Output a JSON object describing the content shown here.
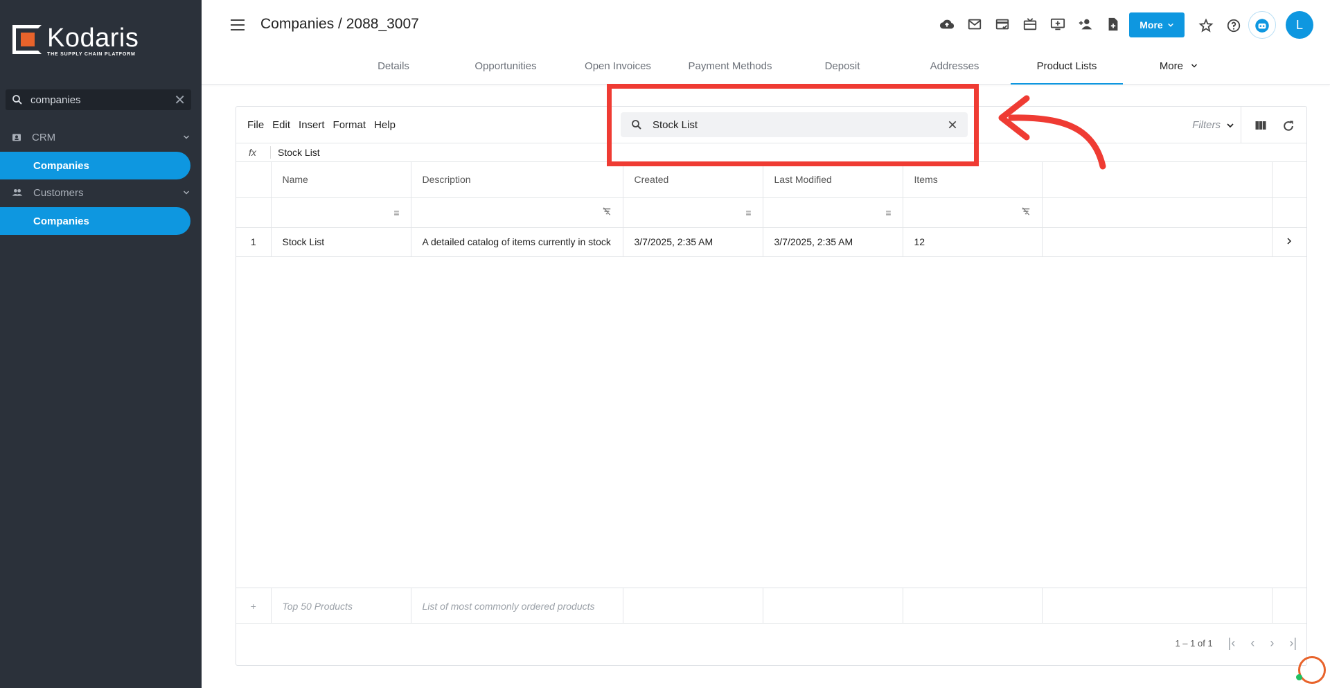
{
  "sidebar": {
    "logo": {
      "name": "Kodaris",
      "tagline": "THE SUPPLY CHAIN PLATFORM"
    },
    "search_value": "companies",
    "groups": [
      {
        "label": "CRM",
        "item": "Companies"
      },
      {
        "label": "Customers",
        "item": "Companies"
      }
    ]
  },
  "header": {
    "title": "Companies / 2088_3007",
    "more_label": "More",
    "avatar_initial": "L",
    "tabs": [
      "Details",
      "Opportunities",
      "Open Invoices",
      "Payment Methods",
      "Deposit",
      "Addresses",
      "Product Lists",
      "More"
    ],
    "active_tab": "Product Lists",
    "icons": [
      "cloud-upload-icon",
      "mail-icon",
      "credit-card-icon",
      "gift-card-icon",
      "add-to-screen-icon",
      "add-person-icon",
      "add-document-icon",
      "attachment-icon"
    ]
  },
  "grid": {
    "menu": [
      "File",
      "Edit",
      "Insert",
      "Format",
      "Help"
    ],
    "search_value": "Stock List",
    "filters_label": "Filters",
    "formula_prefix": "fx",
    "formula_value": "Stock List",
    "columns": [
      "Name",
      "Description",
      "Created",
      "Last Modified",
      "Items"
    ],
    "rows": [
      {
        "num": "1",
        "name": "Stock List",
        "description": "A detailed catalog of items currently in stock",
        "created": "3/7/2025, 2:35 AM",
        "modified": "3/7/2025, 2:35 AM",
        "items": "12"
      }
    ],
    "new_row": {
      "name_placeholder": "Top 50 Products",
      "description_placeholder": "List of most commonly ordered products"
    },
    "pagination": "1 – 1 of 1"
  },
  "colors": {
    "accent": "#0e97e0",
    "sidebar": "#2b313a",
    "annotation": "#ef3b33",
    "brand_orange": "#e8632b"
  }
}
